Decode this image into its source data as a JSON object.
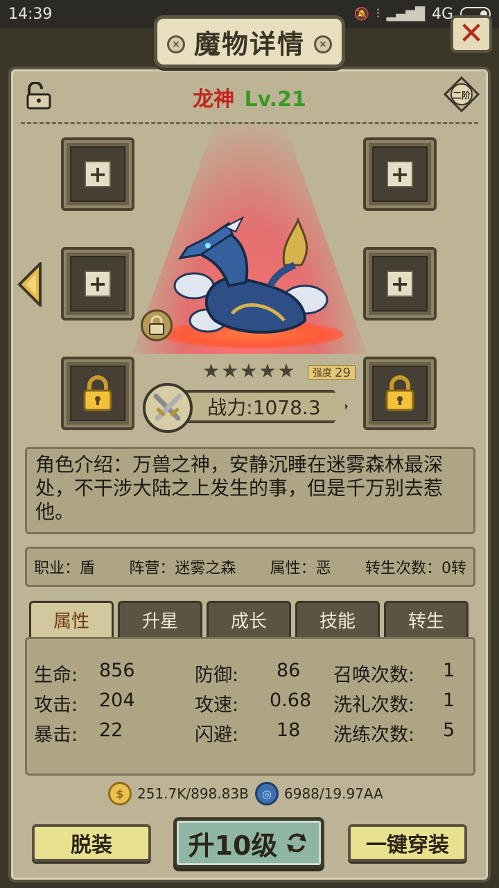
{
  "status_bar": {
    "time": "14:39",
    "network": "4G",
    "icons": [
      "mute-icon",
      "vibrate-icon",
      "signal-icon",
      "battery-icon"
    ]
  },
  "header": {
    "title": "魔物详情",
    "close_glyph": "✕"
  },
  "monster": {
    "name": "龙神",
    "level": "Lv.21",
    "tier": "二阶",
    "stars_count": 5,
    "strength_label": "强度",
    "strength_value": "29",
    "power": "战力:1078.3"
  },
  "description": "角色介绍：万兽之神，安静沉睡在迷雾森林最深处，不干涉大陆之上发生的事，但是千万别去惹他。",
  "info": {
    "job": "职业：盾",
    "camp": "阵营：迷雾之森",
    "attribute": "属性：恶",
    "rebirth": "转生次数：0转"
  },
  "tabs": [
    {
      "label": "属性",
      "active": true
    },
    {
      "label": "升星",
      "active": false
    },
    {
      "label": "成长",
      "active": false
    },
    {
      "label": "技能",
      "active": false
    },
    {
      "label": "转生",
      "active": false
    }
  ],
  "stats": {
    "rows": [
      [
        {
          "label": "生命:",
          "value": "856"
        },
        {
          "label": "防御:",
          "value": "86"
        },
        {
          "label": "召唤次数:",
          "value": "1"
        }
      ],
      [
        {
          "label": "攻击:",
          "value": "204"
        },
        {
          "label": "攻速:",
          "value": "0.68"
        },
        {
          "label": "洗礼次数:",
          "value": "1"
        }
      ],
      [
        {
          "label": "暴击:",
          "value": "22"
        },
        {
          "label": "闪避:",
          "value": "18"
        },
        {
          "label": "洗练次数:",
          "value": "5"
        }
      ]
    ]
  },
  "currency": {
    "gold": "251.7K/898.83B",
    "gem": "6988/19.97AA"
  },
  "buttons": {
    "unequip": "脱装",
    "level_up": "升10级",
    "equip_all": "一键穿装"
  },
  "colors": {
    "name_red": "#c4231b",
    "level_green": "#3a9a25",
    "panel_bg": "#bdb496"
  }
}
